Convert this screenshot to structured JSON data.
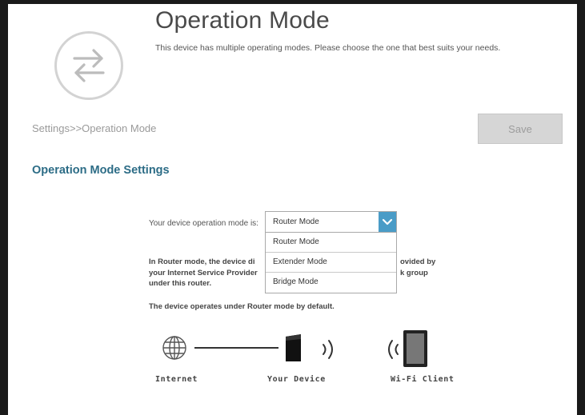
{
  "page": {
    "title": "Operation Mode",
    "subtitle": "This device has multiple operating modes. Please choose the one that best suits your needs.",
    "logo_icon": "swap-arrows-icon"
  },
  "header": {
    "breadcrumb": "Settings>>Operation Mode",
    "save_label": "Save"
  },
  "settings": {
    "section_title": "Operation Mode Settings",
    "mode_label": "Your device operation mode is:",
    "selected_mode": "Router Mode",
    "options": [
      "Router Mode",
      "Extender Mode",
      "Bridge Mode"
    ],
    "description_left": [
      "In Router mode, the device di",
      "your Internet Service Provider",
      "under this router."
    ],
    "description_right": [
      "ovided by",
      "k group"
    ],
    "default_note": "The device operates under Router mode by default."
  },
  "diagram": {
    "internet_label": "Internet",
    "device_label": "Your Device",
    "client_label": "Wi-Fi Client",
    "icons": [
      "globe-icon",
      "router-icon",
      "wifi-signal-icon",
      "tablet-icon"
    ]
  },
  "colors": {
    "accent": "#2c6c86",
    "select_arrow_bg": "#4a9cc7",
    "save_button_bg": "#d6d6d6"
  }
}
